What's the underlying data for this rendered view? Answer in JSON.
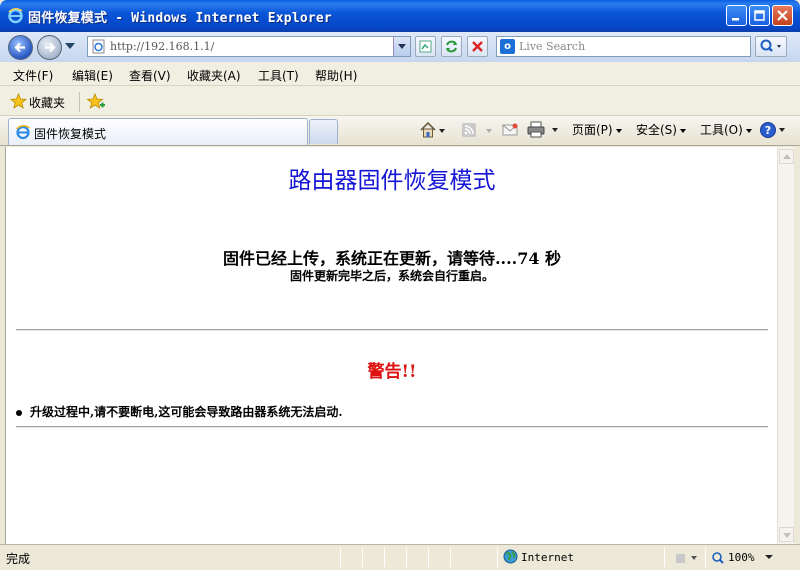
{
  "window": {
    "title": "固件恢复模式 - Windows Internet Explorer"
  },
  "address_bar": {
    "url": "http://192.168.1.1/"
  },
  "search": {
    "placeholder": "Live Search"
  },
  "menu": {
    "items": [
      "文件(F)",
      "编辑(E)",
      "查看(V)",
      "收藏夹(A)",
      "工具(T)",
      "帮助(H)"
    ]
  },
  "favorites_bar": {
    "label": "收藏夹"
  },
  "tabs": [
    {
      "label": "固件恢复模式"
    }
  ],
  "command_bar": {
    "page": "页面(P)",
    "safety": "安全(S)",
    "tools": "工具(O)"
  },
  "page": {
    "heading": "路由器固件恢复模式",
    "progress_text": "固件已经上传，系统正在更新，请等待....74 秒",
    "subtext": "固件更新完毕之后，系统会自行重启。",
    "warning_title": "警告!!",
    "warning_item": "升级过程中,请不要断电,这可能会导致路由器系统无法启动."
  },
  "status_bar": {
    "status": "完成",
    "zone": "Internet",
    "zoom": "100%"
  },
  "colors": {
    "heading": "#1515d6",
    "warning": "#dd1111",
    "titlebar": "#0a56d8"
  }
}
